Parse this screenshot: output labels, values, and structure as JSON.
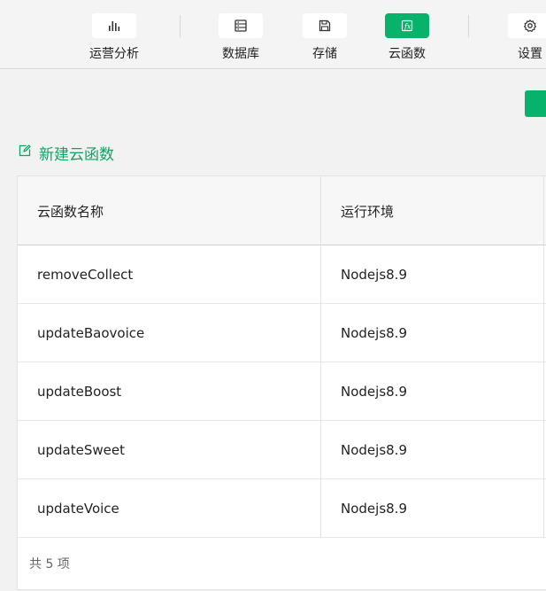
{
  "toolbar": {
    "items": [
      {
        "label": "运营分析",
        "icon": "bar-chart-icon",
        "active": false
      },
      {
        "label": "数据库",
        "icon": "database-icon",
        "active": false
      },
      {
        "label": "存储",
        "icon": "save-icon",
        "active": false
      },
      {
        "label": "云函数",
        "icon": "function-icon",
        "active": true
      },
      {
        "label": "设置",
        "icon": "gear-icon",
        "active": false
      }
    ]
  },
  "actions": {
    "new_function_label": "新建云函数"
  },
  "table": {
    "columns": [
      "云函数名称",
      "运行环境"
    ],
    "rows": [
      {
        "name": "removeCollect",
        "runtime": "Nodejs8.9"
      },
      {
        "name": "updateBaovoice",
        "runtime": "Nodejs8.9"
      },
      {
        "name": "updateBoost",
        "runtime": "Nodejs8.9"
      },
      {
        "name": "updateSweet",
        "runtime": "Nodejs8.9"
      },
      {
        "name": "updateVoice",
        "runtime": "Nodejs8.9"
      }
    ],
    "footer": "共 5 项"
  },
  "colors": {
    "accent": "#07b36a",
    "link": "#07a862"
  }
}
